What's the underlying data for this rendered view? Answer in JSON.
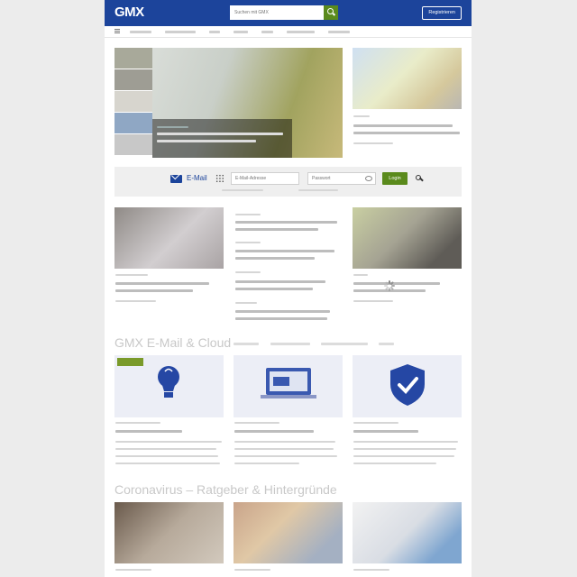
{
  "header": {
    "logo": "GMX",
    "search_placeholder": "Suchen mit GMX",
    "register_label": "Registrieren"
  },
  "nav": {
    "item_count": 8
  },
  "mail": {
    "label": "E-Mail",
    "email_placeholder": "E-Mail-Adresse",
    "password_placeholder": "Passwort",
    "login_label": "Login"
  },
  "sections": {
    "email_cloud_title": "GMX E-Mail & Cloud",
    "corona_title": "Coronavirus – Ratgeber & Hintergründe"
  },
  "colors": {
    "brand": "#1c449b",
    "accent_green": "#5a8a1c"
  }
}
